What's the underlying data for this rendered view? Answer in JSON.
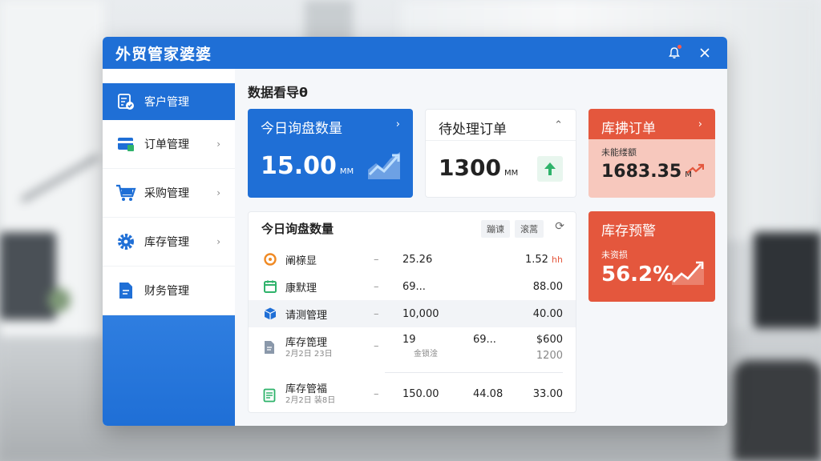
{
  "window": {
    "title": "外贸管家婆婆"
  },
  "sidebar": {
    "items": [
      {
        "label": "客户管理",
        "icon": "customer-icon"
      },
      {
        "label": "订单管理",
        "icon": "order-icon"
      },
      {
        "label": "采购管理",
        "icon": "cart-icon"
      },
      {
        "label": "库存管理",
        "icon": "gear-icon"
      },
      {
        "label": "财务管理",
        "icon": "document-icon"
      }
    ]
  },
  "main": {
    "title": "数据看导θ",
    "cards": {
      "inquiry": {
        "title": "今日询盘数量",
        "value": "15.00",
        "unit": "MM",
        "arrow": "›"
      },
      "pending": {
        "title": "待处理订单",
        "value": "1300",
        "unit": "MM",
        "arrow": "⌃"
      },
      "orders": {
        "title": "库拂订单",
        "subtitle": "未能缕额",
        "value": "1683.35",
        "unit": "M",
        "arrow": "›"
      },
      "stock": {
        "title": "库存预警",
        "subtitle": "未资损",
        "value": "56.2%"
      }
    },
    "table": {
      "title": "今日询盘数量",
      "tabs": [
        "蹦谏",
        "滚蒿"
      ],
      "rows": [
        {
          "name": "阐榇显",
          "dash": "–",
          "c1": "25.26",
          "c3": "1.52",
          "c3_suffix": "hh",
          "icon": "target-icon"
        },
        {
          "name": "康默理",
          "dash": "–",
          "c1": "69...",
          "c3": "88.00",
          "icon": "calendar-icon"
        },
        {
          "name": "请测管理",
          "dash": "–",
          "c1": "10,000",
          "c3": "40.00",
          "icon": "box-icon"
        },
        {
          "name": "库存箆理",
          "sub": "2月2日 23日",
          "dash": "–",
          "c1": "19",
          "c1sub": "金锁淦",
          "c2": "69...",
          "c3": "$600",
          "c3b": "1200",
          "icon": "file-icon"
        },
        {
          "name": "库存管福",
          "sub": "2月2日 装8日",
          "dash": "–",
          "c1": "150.00",
          "c2": "44.08",
          "c3": "33.00",
          "icon": "sheet-icon"
        }
      ]
    }
  },
  "colors": {
    "brand": "#1f6fd6",
    "alert": "#e4573d",
    "alert_soft": "#f7c8bd",
    "success": "#2fb36b"
  }
}
